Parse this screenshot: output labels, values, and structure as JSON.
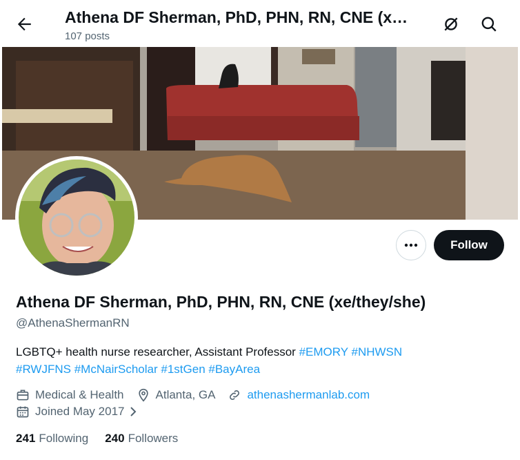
{
  "header": {
    "title": "Athena DF Sherman, PhD, PHN, RN, CNE (x…",
    "post_count": "107 posts"
  },
  "profile": {
    "display_name": "Athena DF Sherman, PhD, PHN, RN, CNE (xe/they/she)",
    "handle": "@AthenaShermanRN",
    "bio_text": "LGBTQ+ health nurse researcher, Assistant Professor ",
    "bio_tags": [
      "#EMORY",
      "#NHWSN",
      "#RWJFNS",
      "#McNairScholar",
      "#1stGen",
      "#BayArea"
    ],
    "category": "Medical & Health",
    "location": "Atlanta, GA",
    "website": "athenashermanlab.com",
    "joined": "Joined May 2017",
    "following_count": "241",
    "following_label": "Following",
    "followers_count": "240",
    "followers_label": "Followers"
  },
  "actions": {
    "follow_label": "Follow",
    "more_label": "•••"
  },
  "colors": {
    "accent": "#1d9bf0",
    "text": "#0f1419",
    "muted": "#536471"
  }
}
